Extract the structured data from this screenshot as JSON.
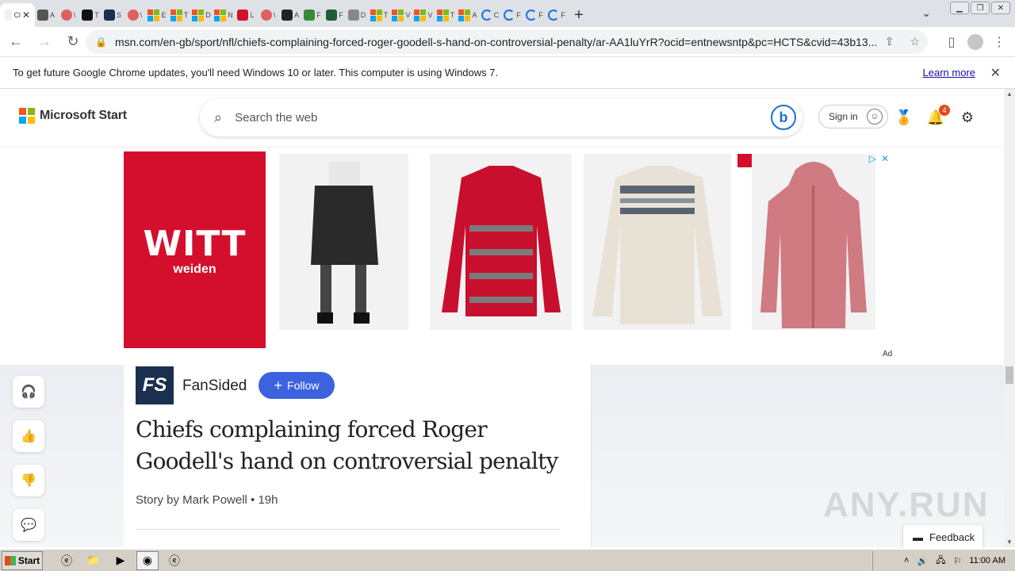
{
  "browser": {
    "tabs": [
      {
        "label": "Cl",
        "icon": "msn-icon",
        "color": "#f0f0f0"
      },
      {
        "label": "A",
        "icon": "pen-icon",
        "color": "#555555"
      },
      {
        "label": "\\",
        "icon": "reddit-icon",
        "color": "#e06060"
      },
      {
        "label": "T",
        "icon": "appletv-icon",
        "color": "#111111"
      },
      {
        "label": "S",
        "icon": "mb-icon",
        "color": "#1b2f4e"
      },
      {
        "label": "\\",
        "icon": "reddit-icon",
        "color": "#e06060"
      },
      {
        "label": "E",
        "icon": "microsoft-icon",
        "color": "#f35325"
      },
      {
        "label": "T",
        "icon": "microsoft-icon",
        "color": "#f35325"
      },
      {
        "label": "D",
        "icon": "microsoft-icon",
        "color": "#f35325"
      },
      {
        "label": "N",
        "icon": "microsoft-icon",
        "color": "#f35325"
      },
      {
        "label": "L",
        "icon": "red-arc-icon",
        "color": "#d40f2d"
      },
      {
        "label": "\\",
        "icon": "reddit-icon",
        "color": "#e06060"
      },
      {
        "label": "A",
        "icon": "amazon-icon",
        "color": "#222222"
      },
      {
        "label": "F",
        "icon": "tag-icon",
        "color": "#3a8a3a"
      },
      {
        "label": "F",
        "icon": "circle-green-icon",
        "color": "#1f5c3a"
      },
      {
        "label": "D",
        "icon": "cecil-icon",
        "color": "#888888"
      },
      {
        "label": "T",
        "icon": "microsoft-icon",
        "color": "#f35325"
      },
      {
        "label": "V",
        "icon": "microsoft-icon",
        "color": "#f35325"
      },
      {
        "label": "V",
        "icon": "microsoft-icon",
        "color": "#f35325"
      },
      {
        "label": "T",
        "icon": "microsoft-icon",
        "color": "#f35325"
      },
      {
        "label": "A",
        "icon": "microsoft-icon",
        "color": "#f35325"
      },
      {
        "label": "C",
        "icon": "loading-icon",
        "color": "#1a73e8"
      },
      {
        "label": "F",
        "icon": "loading-icon",
        "color": "#1a73e8"
      },
      {
        "label": "F",
        "icon": "loading-icon",
        "color": "#1a73e8"
      },
      {
        "label": "F",
        "icon": "loading-icon",
        "color": "#1a73e8"
      }
    ],
    "url": "msn.com/en-gb/sport/nfl/chiefs-complaining-forced-roger-goodell-s-hand-on-controversial-penalty/ar-AA1luYrR?ocid=entnewsntp&pc=HCTS&cvid=43b13...",
    "infobar_text": "To get future Google Chrome updates, you'll need Windows 10 or later. This computer is using Windows 7.",
    "infobar_link": "Learn more"
  },
  "header": {
    "brand": "Microsoft Start",
    "search_placeholder": "Search the web",
    "signin": "Sign in",
    "notif_count": "4"
  },
  "ad": {
    "brand": "WITT",
    "brand_sub": "weiden",
    "label": "Ad",
    "products": [
      {
        "name": "skirt-image",
        "color": "#2a2a2a"
      },
      {
        "name": "red-sweater-image",
        "color": "#c8102e"
      },
      {
        "name": "knit-sweater-image",
        "color": "#e8e2d6"
      },
      {
        "name": "pink-coat-image",
        "color": "#d07a82"
      }
    ]
  },
  "article": {
    "publisher": "FanSided",
    "publisher_logo": "FS",
    "follow": "Follow",
    "headline": "Chiefs complaining forced Roger Goodell's hand on controversial penalty",
    "byline": "Story by Mark Powell  •  19h"
  },
  "feedback": "Feedback",
  "watermark": "ANY.RUN",
  "taskbar": {
    "start": "Start",
    "time": "11:00 AM"
  }
}
